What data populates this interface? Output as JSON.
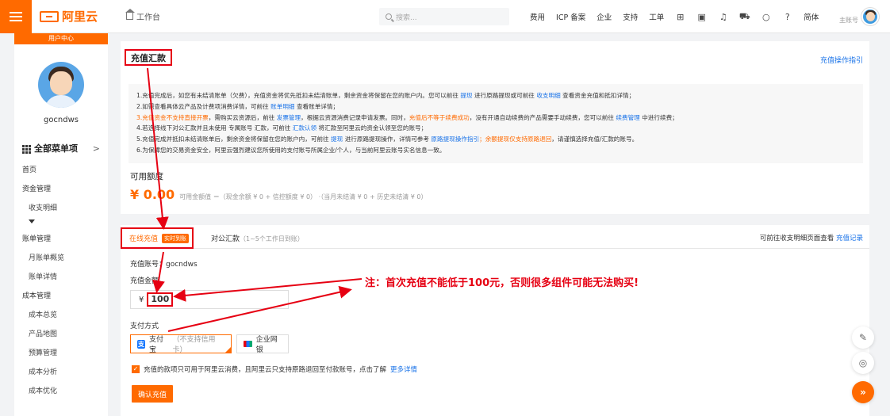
{
  "topbar": {
    "brand": "阿里云",
    "workspace": "工作台",
    "search_placeholder": "搜索...",
    "nav": [
      "费用",
      "ICP 备案",
      "企业",
      "支持",
      "工单"
    ],
    "lang": "简体",
    "account_role": "主账号"
  },
  "sidebar": {
    "user_center": "用户中心",
    "username": "gocndws",
    "all_menu": "全部菜单项",
    "items": [
      {
        "label": "首页",
        "sub": false
      },
      {
        "label": "资金管理",
        "sub": false
      },
      {
        "label": "收支明细",
        "sub": true
      },
      {
        "label": "账单管理",
        "sub": false
      },
      {
        "label": "月账单概览",
        "sub": true
      },
      {
        "label": "账单详情",
        "sub": true
      },
      {
        "label": "成本管理",
        "sub": false
      },
      {
        "label": "成本总览",
        "sub": true
      },
      {
        "label": "产品地图",
        "sub": true
      },
      {
        "label": "预算管理",
        "sub": true
      },
      {
        "label": "成本分析",
        "sub": true
      },
      {
        "label": "成本优化",
        "sub": true
      }
    ]
  },
  "main": {
    "title": "充值汇款",
    "help_link": "充值操作指引",
    "notice": {
      "l1_a": "1.充值完成后，如您有未结清账单（欠费），充值资金将优先抵扣未结清账单，剩余资金将保留在您的账户内。您可以前往",
      "l1_link1": "提现",
      "l1_b": "进行原路提现或可前往",
      "l1_link2": "收支明细",
      "l1_c": "查看资金充值和抵扣详情；",
      "l2_a": "2.如需查看具体云产品及计费项消费详情，可前往",
      "l2_link": "账单明细",
      "l2_b": "查看账单详情；",
      "l3_warn1": "3.充值资金不支持直接开票",
      "l3_a": "，需购买云资源后，前往",
      "l3_link1": "发票管理",
      "l3_b": "，根据云资源消费记录申请发票。同时，",
      "l3_warn2": "充值后不等于续费成功",
      "l3_c": "，没有开通自动续费的产品需要手动续费，您可以前往",
      "l3_link2": "续费管理",
      "l3_d": "中进行续费；",
      "l4_a": "4.若选择线下对公汇款并且未使用 专属账号 汇款，可前往",
      "l4_link": "汇款认领",
      "l4_b": "将汇款至阿里云的资金认领至您的账号；",
      "l5_a": "5.充值完成并抵扣未结清账单后，剩余资金将保留在您的账户内，可前往",
      "l5_link1": "提现",
      "l5_b": "进行原路提现操作，详情可参考",
      "l5_link2": "原路提现操作指引",
      "l5_warn": "；余额提现仅支持原路退回",
      "l5_c": "，请谨慎选择充值/汇款的账号。",
      "l6": "6.为保障您的交易资金安全，阿里云强烈建议您所使用的支付账号所属企业/个人，与当前阿里云账号实名信息一致。"
    },
    "available_title": "可用额度",
    "balance": "¥ 0.00",
    "balance_note": "可用金额值 ＝（现金余额 ¥ 0 + 信控额度 ¥ 0） ·（当月未结清 ¥ 0 + 历史未结清 ¥ 0）"
  },
  "pay": {
    "tab_online": "在线充值",
    "tab_online_badge": "实时到账",
    "tab_corp": "对公汇款",
    "tab_corp_hint": "（1~5个工作日到账）",
    "records_prefix": "可前往收支明细页面查看",
    "records_link": "充值记录",
    "account_label": "充值账号：gocndws",
    "amount_label": "充值金额",
    "currency": "¥",
    "amount_value": "100",
    "method_label": "支付方式",
    "alipay": "支付宝",
    "alipay_hint": "（不支持信用卡）",
    "bank": "企业网银",
    "agree_text": "充值的款项只可用于阿里云消费，且阿里云只支持原路退回至付款账号，点击了解",
    "agree_link": "更多详情",
    "confirm": "确认充值"
  },
  "annotation": "注：首次充值不能低于100元，否则很多组件可能无法购买!",
  "colors": {
    "brand": "#ff6a00",
    "highlight_red": "#e60012",
    "link": "#1a73e8"
  }
}
